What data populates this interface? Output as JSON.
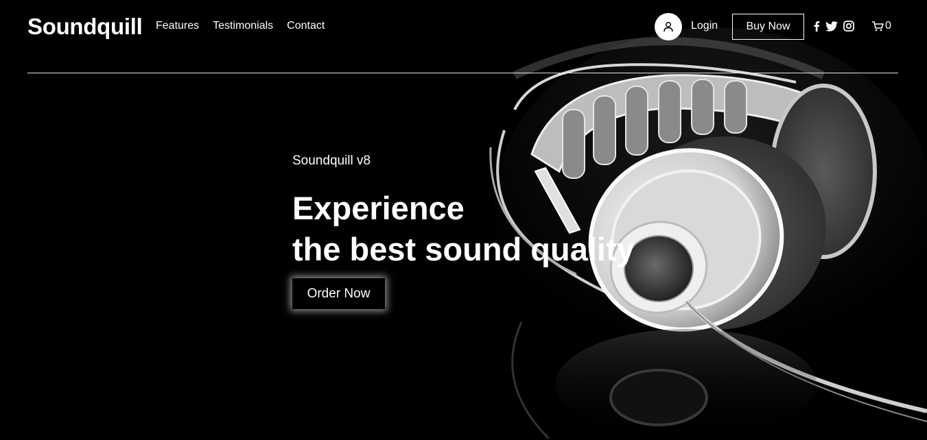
{
  "header": {
    "brand": "Soundquill",
    "nav": [
      {
        "label": "Features"
      },
      {
        "label": "Testimonials"
      },
      {
        "label": "Contact"
      }
    ],
    "login_label": "Login",
    "buy_label": "Buy Now",
    "social_icons": [
      "facebook-icon",
      "twitter-icon",
      "instagram-icon"
    ],
    "cart_count": "0"
  },
  "hero": {
    "subtitle": "Soundquill v8",
    "title_line1": "Experience",
    "title_line2": "the best sound quality",
    "cta_label": "Order Now",
    "image": "headphones-photo"
  },
  "colors": {
    "background": "#000000",
    "text": "#ffffff",
    "divider": "#e8e8e8"
  }
}
